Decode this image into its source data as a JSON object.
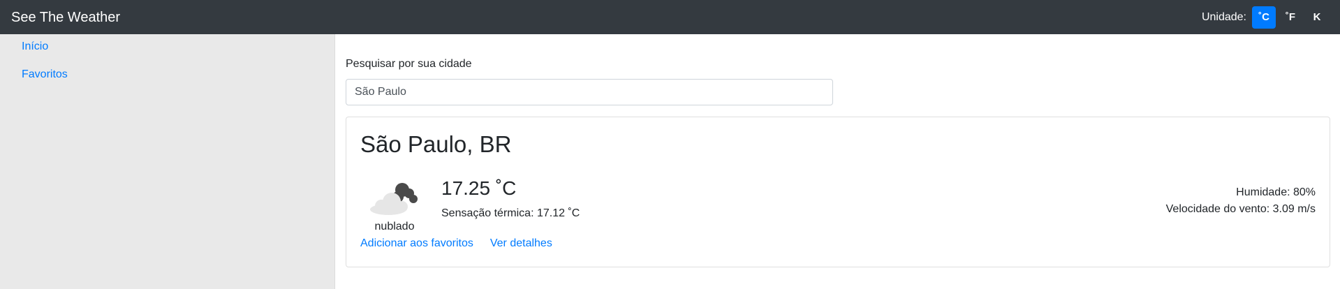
{
  "navbar": {
    "brand": "See The Weather",
    "unit_label": "Unidade:",
    "units": [
      "˚C",
      "˚F",
      "K"
    ],
    "active_unit": "˚C",
    "background_color": "#343a40",
    "accent_color": "#007bff"
  },
  "sidebar": {
    "items": [
      {
        "label": "Início"
      },
      {
        "label": "Favoritos"
      }
    ]
  },
  "search": {
    "label": "Pesquisar por sua cidade",
    "value": "São Paulo"
  },
  "weather": {
    "city": "São Paulo, BR",
    "icon": "cloudy-icon",
    "condition": "nublado",
    "temperature": "17.25 ˚C",
    "feels_like": "Sensação térmica: 17.12 ˚C",
    "humidity": "Humidade: 80%",
    "wind": "Velocidade do vento: 3.09 m/s",
    "actions": {
      "favorite": "Adicionar aos favoritos",
      "details": "Ver detalhes"
    }
  }
}
